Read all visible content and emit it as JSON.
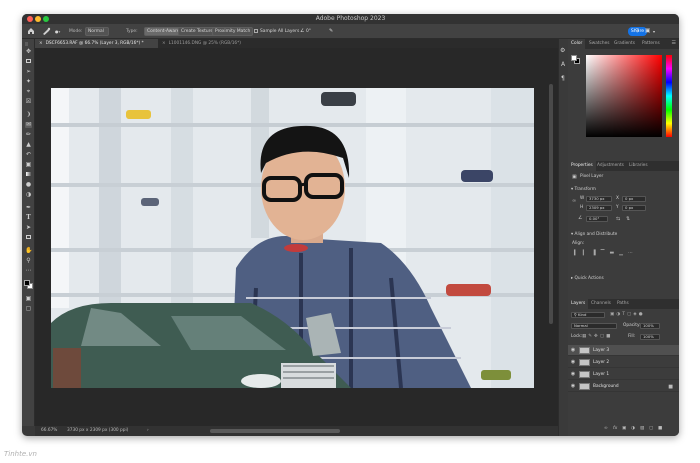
{
  "window": {
    "title": "Adobe Photoshop 2023"
  },
  "options_bar": {
    "mode_label": "Mode:",
    "mode_value": "Normal",
    "type_label": "Type:",
    "content_aware": "Content-Aware",
    "create_texture": "Create Texture",
    "proximity_match": "Proximity Match",
    "sample_all_layers": "Sample All Layers",
    "angle_value": "0°",
    "share_label": "Share"
  },
  "tabs": [
    {
      "label": "DSCF6653.RAF @ 66.7% (Layer 3, RGB/16*) *",
      "close": "×"
    },
    {
      "label": "L1001146.DNG @ 25% (RGB/16*)",
      "close": "×"
    }
  ],
  "status": {
    "zoom": "66.67%",
    "dims": "3730 px x 2309 px (300 ppi)"
  },
  "color_panel": {
    "tabs": [
      "Color",
      "Swatches",
      "Gradients",
      "Patterns"
    ]
  },
  "properties_panel": {
    "tabs": [
      "Properties",
      "Adjustments",
      "Libraries"
    ],
    "layer_type": "Pixel Layer",
    "transform_header": "Transform",
    "w_label": "W",
    "w_value": "3730 px",
    "h_label": "H",
    "h_value": "2309 px",
    "x_label": "X",
    "x_value": "0 px",
    "y_label": "Y",
    "y_value": "0 px",
    "angle_value": "0.00°",
    "align_header": "Align and Distribute",
    "align_label": "Align:",
    "quick_actions": "Quick Actions"
  },
  "layers_panel": {
    "tabs": [
      "Layers",
      "Channels",
      "Paths"
    ],
    "filter_kind": "Kind",
    "blend_mode": "Normal",
    "opacity_label": "Opacity:",
    "opacity_value": "100%",
    "lock_label": "Lock:",
    "fill_label": "Fill:",
    "fill_value": "100%",
    "layers": [
      {
        "name": "Layer 3"
      },
      {
        "name": "Layer 2"
      },
      {
        "name": "Layer 1"
      },
      {
        "name": "Background"
      }
    ],
    "footer_fx": "fx"
  },
  "watermark": "Tinhte.vn",
  "colors": {
    "accent": "#1473e6",
    "panel_bg": "#3c3c3c",
    "canvas_bg": "#282828"
  },
  "icons": [
    "move-icon",
    "marquee-icon",
    "lasso-icon",
    "quick-select-icon",
    "crop-icon",
    "frame-icon",
    "eyedropper-icon",
    "healing-brush-icon",
    "brush-icon",
    "clone-stamp-icon",
    "history-brush-icon",
    "eraser-icon",
    "gradient-icon",
    "blur-icon",
    "dodge-icon",
    "pen-icon",
    "type-icon",
    "path-select-icon",
    "rectangle-icon",
    "hand-icon",
    "zoom-icon",
    "more-tools-icon",
    "foreground-background-icon",
    "quick-mask-icon",
    "screen-mode-icon"
  ]
}
